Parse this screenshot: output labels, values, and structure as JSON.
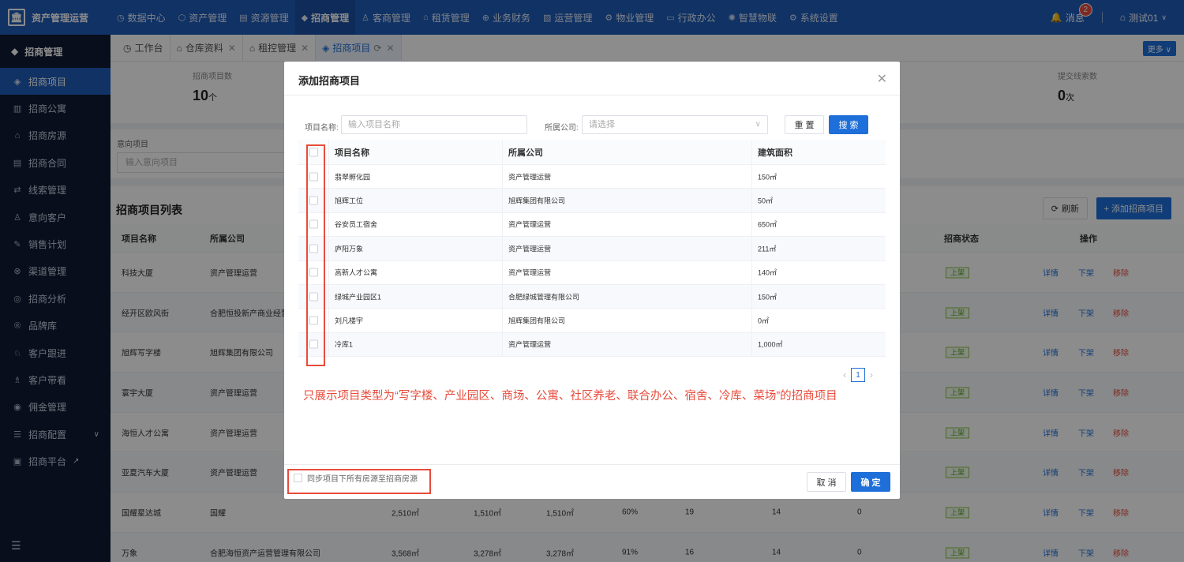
{
  "app": {
    "title": "资产管理运营",
    "logo_icon": "bank-icon"
  },
  "topnav": [
    {
      "label": "数据中心",
      "icon": "clock-icon",
      "active": false
    },
    {
      "label": "资产管理",
      "icon": "cube-icon",
      "active": false
    },
    {
      "label": "资源管理",
      "icon": "doc-icon",
      "active": false
    },
    {
      "label": "招商管理",
      "icon": "tag-icon",
      "active": true
    },
    {
      "label": "客商管理",
      "icon": "people-icon",
      "active": false
    },
    {
      "label": "租赁管理",
      "icon": "house-icon",
      "active": false
    },
    {
      "label": "业务财务",
      "icon": "coin-icon",
      "active": false
    },
    {
      "label": "运营管理",
      "icon": "chart-icon",
      "active": false
    },
    {
      "label": "物业管理",
      "icon": "gear-icon",
      "active": false
    },
    {
      "label": "行政办公",
      "icon": "monitor-icon",
      "active": false
    },
    {
      "label": "智慧物联",
      "icon": "sun-icon",
      "active": false
    },
    {
      "label": "系统设置",
      "icon": "settings-icon",
      "active": false
    }
  ],
  "user": {
    "messages_label": "消息",
    "messages_count": "2",
    "name": "测试01"
  },
  "sidebar": {
    "header": "招商管理",
    "items": [
      {
        "label": "招商项目",
        "icon": "project-icon",
        "active": true
      },
      {
        "label": "招商公寓",
        "icon": "building-icon",
        "active": false
      },
      {
        "label": "招商房源",
        "icon": "home-icon",
        "active": false
      },
      {
        "label": "招商合同",
        "icon": "contract-icon",
        "active": false
      },
      {
        "label": "线索管理",
        "icon": "lead-icon",
        "active": false
      },
      {
        "label": "意向客户",
        "icon": "user-icon",
        "active": false
      },
      {
        "label": "销售计划",
        "icon": "plan-icon",
        "active": false
      },
      {
        "label": "渠道管理",
        "icon": "channel-icon",
        "active": false
      },
      {
        "label": "招商分析",
        "icon": "analysis-icon",
        "active": false
      },
      {
        "label": "品牌库",
        "icon": "brand-icon",
        "active": false
      },
      {
        "label": "客户跟进",
        "icon": "follow-icon",
        "active": false
      },
      {
        "label": "客户带看",
        "icon": "visit-icon",
        "active": false
      },
      {
        "label": "佣金管理",
        "icon": "commission-icon",
        "active": false
      },
      {
        "label": "招商配置",
        "icon": "config-icon",
        "active": false,
        "has_caret": true
      },
      {
        "label": "招商平台",
        "icon": "platform-icon",
        "active": false,
        "external": true
      }
    ]
  },
  "tabs": [
    {
      "label": "工作台",
      "closable": false,
      "active": false
    },
    {
      "label": "仓库资料",
      "closable": true,
      "active": false
    },
    {
      "label": "租控管理",
      "closable": true,
      "active": false
    },
    {
      "label": "招商项目",
      "closable": true,
      "active": true
    }
  ],
  "more_label": "更多",
  "stats": [
    {
      "label": "招商项目数",
      "value": "10",
      "unit": "个"
    },
    {
      "label": "提交线索数",
      "value": "0",
      "unit": "次"
    }
  ],
  "filter": {
    "label": "意向项目",
    "placeholder": "输入意向项目"
  },
  "list": {
    "title": "招商项目列表",
    "refresh_label": "刷新",
    "add_label": "+ 添加招商项目",
    "headers": {
      "name": "项目名称",
      "company": "所属公司",
      "status": "招商状态",
      "ops": "操作"
    },
    "rows": [
      {
        "name": "科技大厦",
        "company": "资产管理运营",
        "a": "",
        "b": "",
        "c": "",
        "d": "",
        "e": "",
        "f": "",
        "g": "",
        "status": "上架"
      },
      {
        "name": "经开区欧风街",
        "company": "合肥恒投新产商业经营",
        "a": "",
        "b": "",
        "c": "",
        "d": "",
        "e": "",
        "f": "",
        "g": "",
        "status": "上架"
      },
      {
        "name": "旭辉写字楼",
        "company": "旭辉集团有限公司",
        "a": "",
        "b": "",
        "c": "",
        "d": "",
        "e": "",
        "f": "",
        "g": "",
        "status": "上架"
      },
      {
        "name": "寰宇大厦",
        "company": "资产管理运营",
        "a": "",
        "b": "",
        "c": "",
        "d": "",
        "e": "",
        "f": "",
        "g": "",
        "status": "上架"
      },
      {
        "name": "海恒人才公寓",
        "company": "资产管理运营",
        "a": "",
        "b": "",
        "c": "",
        "d": "",
        "e": "",
        "f": "",
        "g": "",
        "status": "上架"
      },
      {
        "name": "亚夏汽车大厦",
        "company": "资产管理运营",
        "a": "",
        "b": "",
        "c": "",
        "d": "",
        "e": "",
        "f": "",
        "g": "",
        "status": "上架"
      },
      {
        "name": "国耀星达城",
        "company": "国耀",
        "a": "2,510㎡",
        "b": "1,510㎡",
        "c": "1,510㎡",
        "d": "60%",
        "e": "19",
        "f": "14",
        "g": "0",
        "status": "上架"
      },
      {
        "name": "万象",
        "company": "合肥海恒资产运营管理有限公司",
        "a": "3,568㎡",
        "b": "3,278㎡",
        "c": "3,278㎡",
        "d": "91%",
        "e": "16",
        "f": "14",
        "g": "0",
        "status": "上架"
      }
    ],
    "op_detail": "详情",
    "op_offshelf": "下架",
    "op_remove": "移除"
  },
  "modal": {
    "title": "添加招商项目",
    "name_label": "项目名称:",
    "name_placeholder": "输入项目名称",
    "company_label": "所属公司:",
    "company_placeholder": "请选择",
    "reset_label": "重 置",
    "search_label": "搜 索",
    "headers": {
      "name": "项目名称",
      "company": "所属公司",
      "area": "建筑面积"
    },
    "rows": [
      {
        "name": "翡翠孵化园",
        "company": "资产管理运营",
        "area": "150㎡"
      },
      {
        "name": "旭辉工位",
        "company": "旭辉集团有限公司",
        "area": "50㎡"
      },
      {
        "name": "谷安员工宿舍",
        "company": "资产管理运营",
        "area": "650㎡"
      },
      {
        "name": "庐阳万象",
        "company": "资产管理运营",
        "area": "211㎡"
      },
      {
        "name": "高新人才公寓",
        "company": "资产管理运营",
        "area": "140㎡"
      },
      {
        "name": "绿城产业园区1",
        "company": "合肥绿城管理有限公司",
        "area": "150㎡"
      },
      {
        "name": "刘凡楼宇",
        "company": "旭辉集团有限公司",
        "area": "0㎡"
      },
      {
        "name": "冷库1",
        "company": "资产管理运营",
        "area": "1,000㎡"
      }
    ],
    "page": "1",
    "note": "只展示项目类型为“写字楼、产业园区、商场、公寓、社区养老、联合办公、宿舍、冷库、菜场”的招商项目",
    "sync_label": "同步项目下所有房源至招商房源",
    "cancel_label": "取 消",
    "ok_label": "确 定"
  }
}
